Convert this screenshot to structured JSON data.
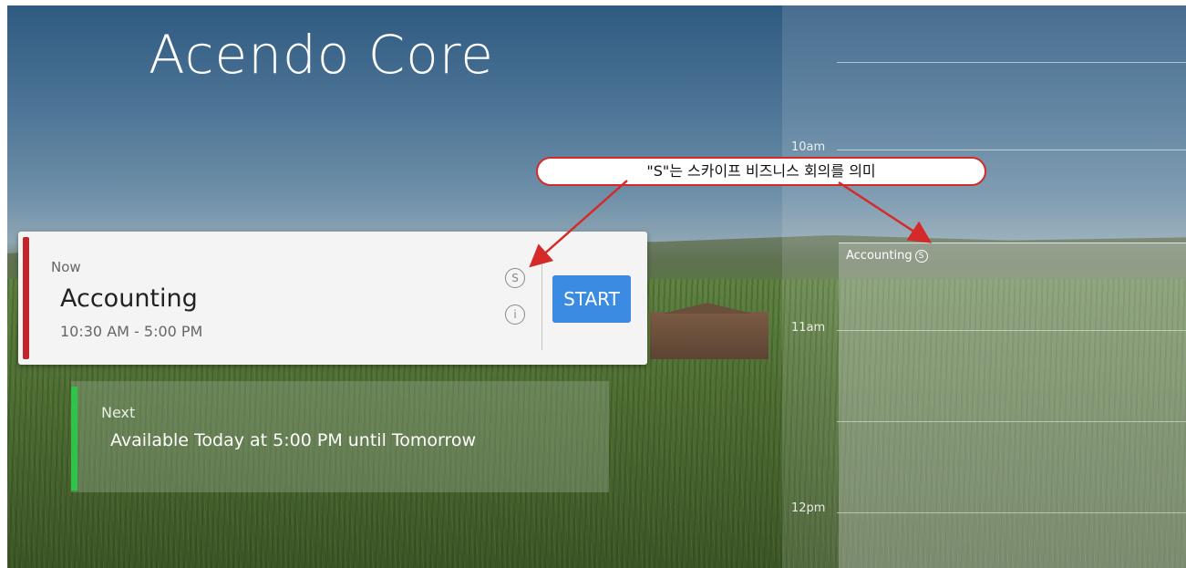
{
  "app": {
    "title": "Acendo Core"
  },
  "timeline": {
    "hours": [
      {
        "label": "10am"
      },
      {
        "label": "11am"
      },
      {
        "label": "12pm"
      }
    ],
    "event": {
      "title": "Accounting",
      "skype_symbol": "S"
    }
  },
  "now": {
    "label": "Now",
    "title": "Accounting",
    "time": "10:30 AM - 5:00 PM",
    "skype_icon_char": "S",
    "info_icon_char": "i",
    "start_label": "START",
    "indicator_color": "#c0262c"
  },
  "next": {
    "label": "Next",
    "text": "Available Today at 5:00 PM until Tomorrow",
    "indicator_color": "#2ec44a"
  },
  "annotation": {
    "text": "\"S\"는 스카이프 비즈니스 회의를 의미",
    "color": "#d42a2a"
  },
  "colors": {
    "start_button": "#3b8be2",
    "accent_red": "#c0262c",
    "accent_green": "#2ec44a"
  }
}
